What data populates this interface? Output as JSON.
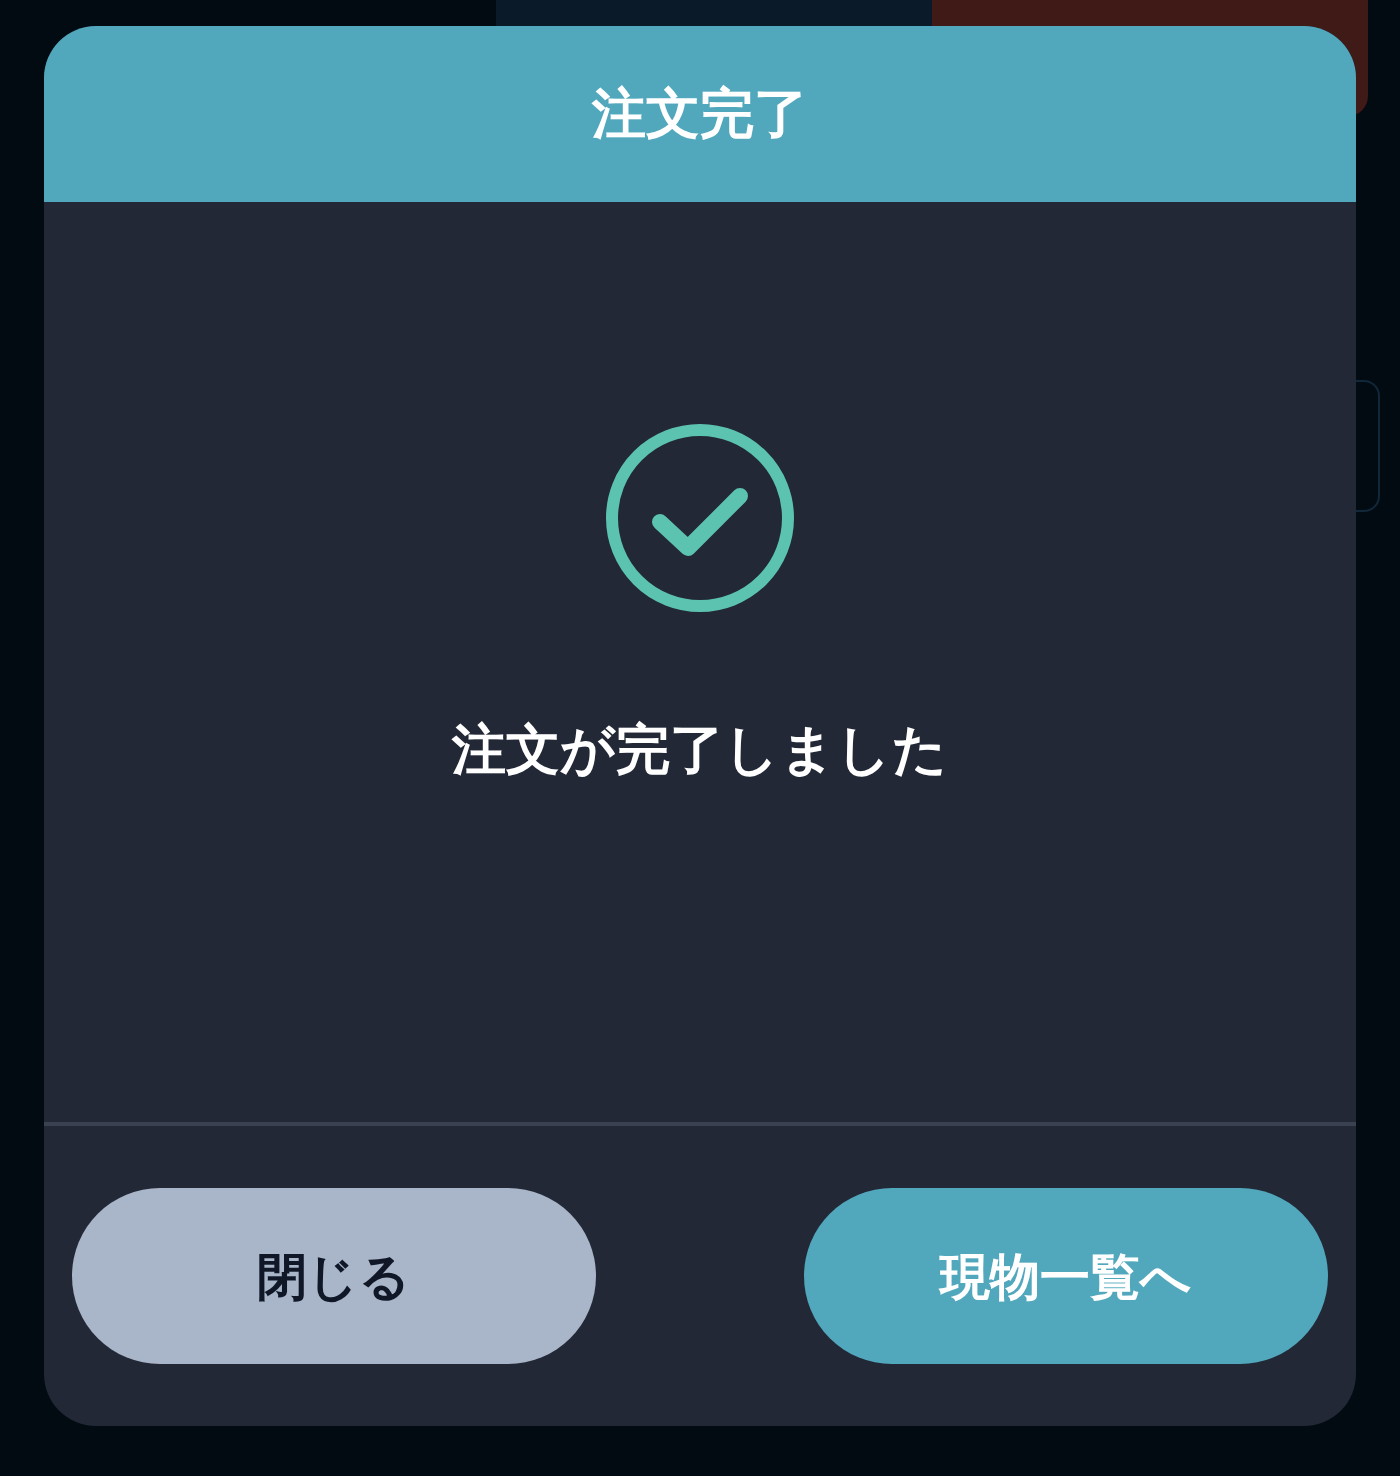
{
  "dialog": {
    "title": "注文完了",
    "message": "注文が完了しました",
    "completed": true
  },
  "buttons": [
    {
      "label": "閉じる",
      "kind": "secondary"
    },
    {
      "label": "現物一覧へ",
      "kind": "primary"
    }
  ]
}
